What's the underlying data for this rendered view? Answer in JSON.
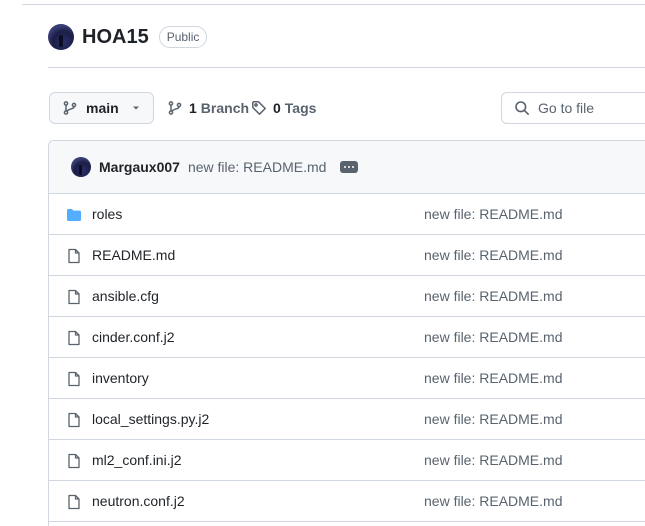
{
  "repo": {
    "name": "HOA15",
    "visibility": "Public"
  },
  "toolbar": {
    "branch_label": "main",
    "branches_count": "1",
    "branches_label": "Branch",
    "tags_count": "0",
    "tags_label": "Tags",
    "search_placeholder": "Go to file"
  },
  "commit": {
    "author": "Margaux007",
    "message": "new file: README.md"
  },
  "files": [
    {
      "name": "roles",
      "type": "folder",
      "message": "new file: README.md"
    },
    {
      "name": "README.md",
      "type": "file",
      "message": "new file: README.md"
    },
    {
      "name": "ansible.cfg",
      "type": "file",
      "message": "new file: README.md"
    },
    {
      "name": "cinder.conf.j2",
      "type": "file",
      "message": "new file: README.md"
    },
    {
      "name": "inventory",
      "type": "file",
      "message": "new file: README.md"
    },
    {
      "name": "local_settings.py.j2",
      "type": "file",
      "message": "new file: README.md"
    },
    {
      "name": "ml2_conf.ini.j2",
      "type": "file",
      "message": "new file: README.md"
    },
    {
      "name": "neutron.conf.j2",
      "type": "file",
      "message": "new file: README.md"
    }
  ],
  "colors": {
    "folder_icon": "#54aeff",
    "file_icon": "#59636e",
    "border": "#d0d7de",
    "muted_text": "#59636e"
  }
}
